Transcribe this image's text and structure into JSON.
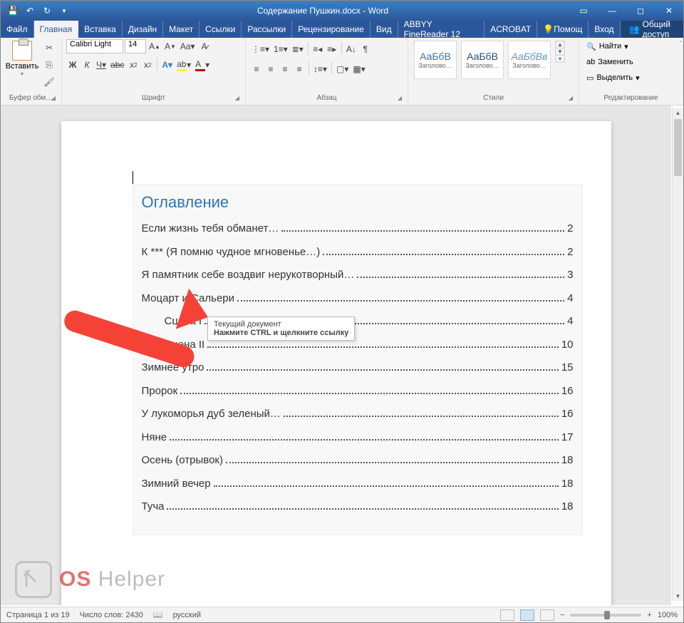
{
  "title": "Содержание Пушкин.docx - Word",
  "tabs": {
    "file": "Файл",
    "home": "Главная",
    "insert": "Вставка",
    "design": "Дизайн",
    "layout": "Макет",
    "references": "Ссылки",
    "mailings": "Рассылки",
    "review": "Рецензирование",
    "view": "Вид",
    "finereader": "ABBYY FineReader 12",
    "acrobat": "ACROBAT",
    "tell": "Помощ",
    "signin": "Вход",
    "share": "Общий доступ"
  },
  "ribbon": {
    "clipboard": {
      "label": "Буфер обм…",
      "paste": "Вставить"
    },
    "font": {
      "label": "Шрифт",
      "name": "Calibri Light",
      "size": "14"
    },
    "paragraph": {
      "label": "Абзац"
    },
    "styles": {
      "label": "Стили",
      "sample": "АаБбВ",
      "sample_it": "АаБбВв",
      "cap1": "Заголово…",
      "cap2": "Заголово…",
      "cap3": "Заголово…"
    },
    "editing": {
      "label": "Редактирование",
      "find": "Найти",
      "replace": "Заменить",
      "select": "Выделить"
    }
  },
  "toc": {
    "title": "Оглавление",
    "items": [
      {
        "label": "Если жизнь тебя обманет…",
        "page": "2",
        "indent": false
      },
      {
        "label": "К *** (Я помню чудное мгновенье…)",
        "page": "2",
        "indent": false
      },
      {
        "label": "Я памятник себе воздвиг нерукотворный…",
        "page": "3",
        "indent": false
      },
      {
        "label": "Моцарт и Сальери",
        "page": "4",
        "indent": false
      },
      {
        "label": "Сцена I",
        "page": "4",
        "indent": true
      },
      {
        "label": "Сцена II",
        "page": "10",
        "indent": true
      },
      {
        "label": "Зимнее утро",
        "page": "15",
        "indent": false
      },
      {
        "label": "Пророк",
        "page": "16",
        "indent": false
      },
      {
        "label": "У лукоморья дуб зеленый…",
        "page": "16",
        "indent": false
      },
      {
        "label": "Няне",
        "page": "17",
        "indent": false
      },
      {
        "label": "Осень (отрывок)",
        "page": "18",
        "indent": false
      },
      {
        "label": "Зимний вечер",
        "page": "18",
        "indent": false
      },
      {
        "label": "Туча",
        "page": "18",
        "indent": false
      }
    ]
  },
  "tooltip": {
    "line1": "Текущий документ",
    "line2": "Нажмите CTRL и щелкните ссылку"
  },
  "status": {
    "page": "Страница 1 из 19",
    "words": "Число слов: 2430",
    "lang": "русский",
    "zoom": "100%"
  },
  "watermark": {
    "os": "OS",
    "helper": "Helper"
  }
}
